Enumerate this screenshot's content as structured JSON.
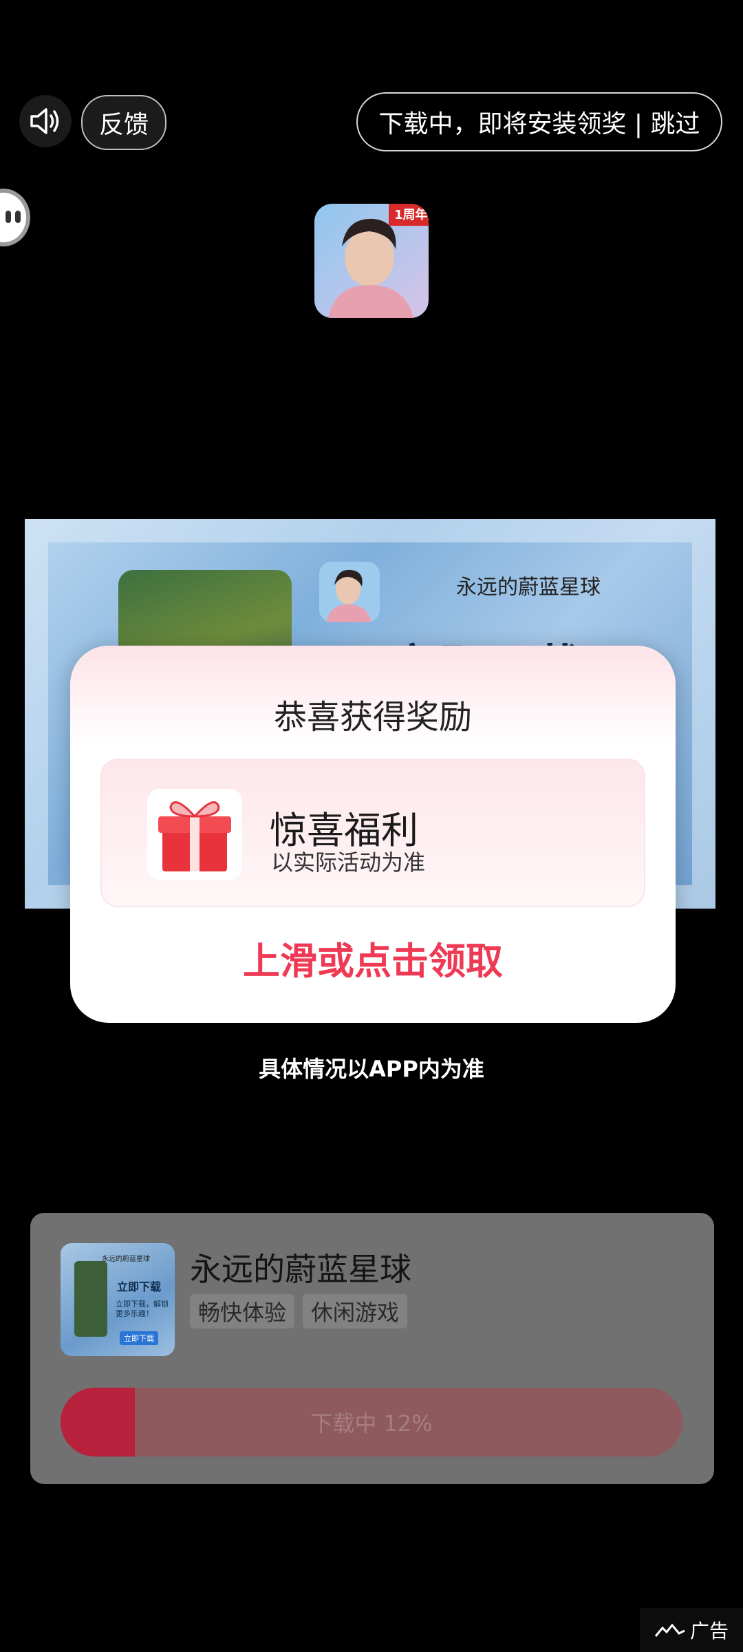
{
  "top_bar": {
    "feedback_label": "反馈",
    "skip_label": "下载中，即将安装领奖 | 跳过"
  },
  "app_icon": {
    "badge": "1周年"
  },
  "banner": {
    "game_title": "永远的蔚蓝星球",
    "big_text": "立即下载"
  },
  "reward": {
    "title": "恭喜获得奖励",
    "gift_name": "惊喜福利",
    "gift_desc": "以实际活动为准",
    "claim": "上滑或点击领取"
  },
  "note": "具体情况以APP内为准",
  "download_panel": {
    "thumb_text": {
      "small": "永远的蔚蓝星球",
      "title": "立即下载",
      "desc": "立即下载，解锁更多乐趣！",
      "button": "立即下载"
    },
    "app_name": "永远的蔚蓝星球",
    "tags": [
      "畅快体验",
      "休闲游戏"
    ],
    "progress_label": "下载中 12%",
    "progress_value": 0.12
  },
  "ad_label": "广告",
  "colors": {
    "accent": "#ee3a55",
    "progress_fill": "#b8213b"
  }
}
